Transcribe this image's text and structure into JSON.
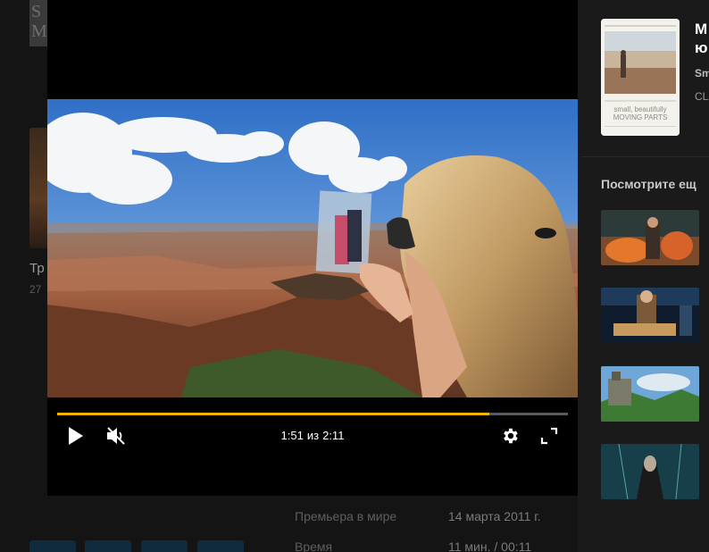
{
  "background_page": {
    "top_thumb_text": "S\nM",
    "card_title": "Тр",
    "card_sub": "27",
    "rows": [
      {
        "label": "Премьера в мире",
        "value": "14 марта 2011 г."
      },
      {
        "label": "Время",
        "value": "11 мин. / 00:11"
      }
    ]
  },
  "player": {
    "progress_percent": 84.7,
    "current_time": "1:51",
    "separator": "из",
    "duration": "2:11",
    "icons": {
      "play": "play-icon",
      "mute": "volume-muted-icon",
      "settings": "gear-icon",
      "fullscreen": "fullscreen-icon"
    },
    "accent_color": "#f5b400"
  },
  "sidebar": {
    "movie_title": "М\nю",
    "meta_line1": "Sm",
    "meta_line2": "CL",
    "poster_caption": "small, beautifully\nMOVING PARTS",
    "more_heading": "Посмотрите ещ",
    "related_count": 4
  }
}
